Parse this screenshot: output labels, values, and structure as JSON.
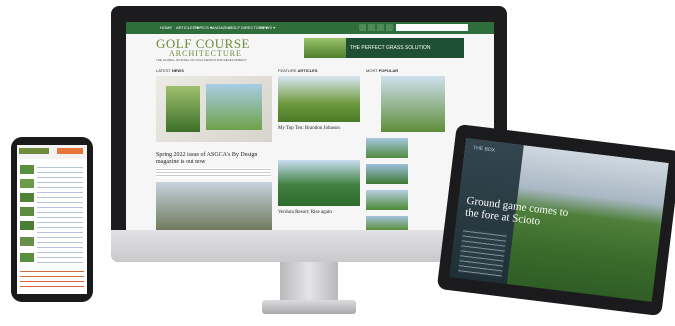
{
  "desktop": {
    "nav": [
      "HOME",
      "ARTICLES ▾",
      "TOPICS ▾",
      "MAGAZINE",
      "GOLF DIRECTORY ▾",
      "NEWS ▾"
    ],
    "logo": {
      "line1": "GOLF COURSE",
      "line2": "ARCHITECTURE",
      "tagline": "THE GLOBAL JOURNAL OF GOLF DESIGN AND DEVELOPMENT"
    },
    "banner": "THE PERFECT GRASS SOLUTION",
    "sections": {
      "latest_prefix": "LATEST",
      "latest": "NEWS",
      "featured_prefix": "FEATURE",
      "featured": "ARTICLES",
      "most_prefix": "MOST",
      "most": "POPULAR"
    },
    "articles": [
      {
        "title": "Spring 2022 issue of ASGCA's By Design magazine is out now"
      },
      {
        "title": "My Top Ten: Brandon Johnson"
      },
      {
        "title": "Verdura Resort: Rise again"
      }
    ]
  },
  "tablet": {
    "kicker": "THE BOX",
    "headline": "Ground game comes to the fore at Scioto"
  },
  "colors": {
    "nav": "#2f6d3a",
    "logo": "#6f8b3c",
    "bezel": "#1c1c1e"
  }
}
